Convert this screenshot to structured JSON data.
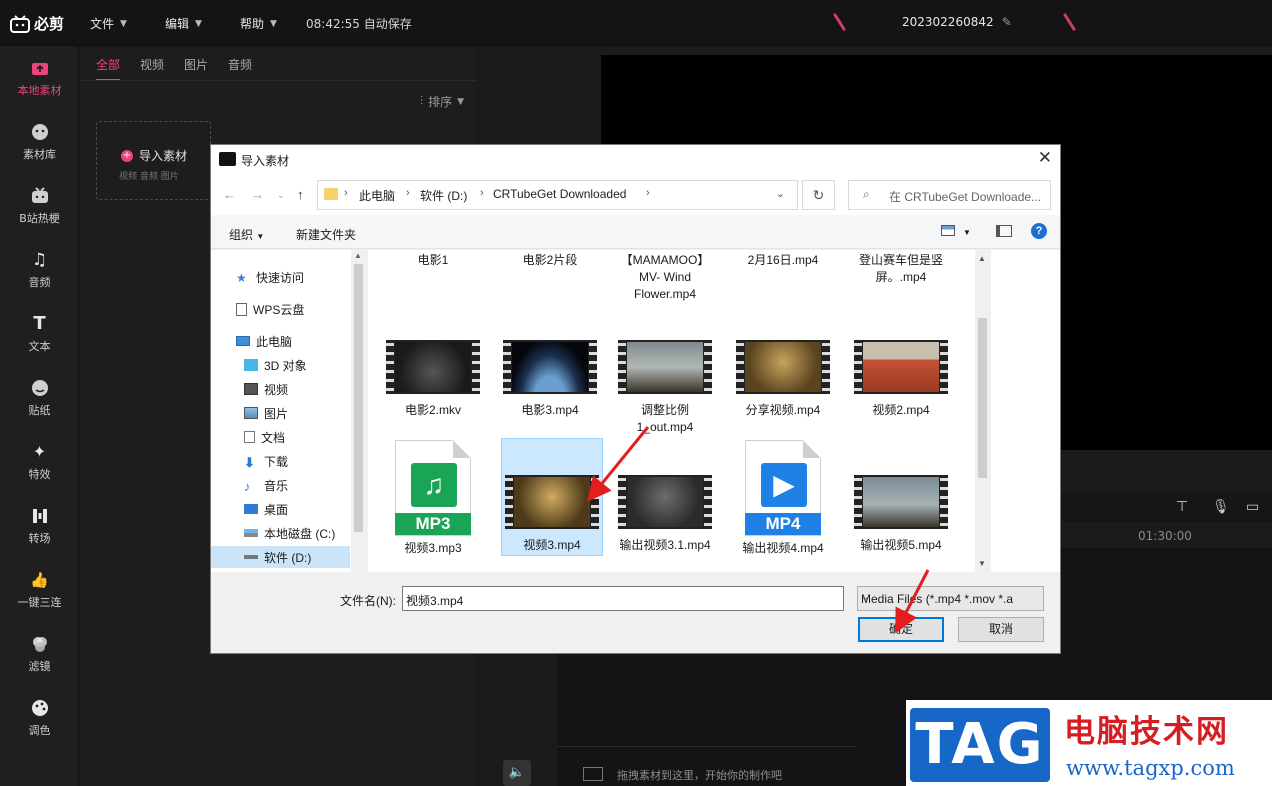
{
  "app": {
    "logo_text": "必剪",
    "menus": [
      "文件",
      "编辑",
      "帮助"
    ],
    "autosave": "08:42:55 自动保存",
    "project_name": "202302260842"
  },
  "sidebar": {
    "items": [
      {
        "label": "本地素材",
        "icon": "upload-icon"
      },
      {
        "label": "素材库",
        "icon": "face-icon"
      },
      {
        "label": "B站热梗",
        "icon": "tv-icon"
      },
      {
        "label": "音频",
        "icon": "music-note-icon"
      },
      {
        "label": "文本",
        "icon": "text-icon"
      },
      {
        "label": "贴纸",
        "icon": "sticker-icon"
      },
      {
        "label": "特效",
        "icon": "star-icon"
      },
      {
        "label": "转场",
        "icon": "transition-icon"
      },
      {
        "label": "一键三连",
        "icon": "thumbs-up-icon"
      },
      {
        "label": "滤镜",
        "icon": "filter-icon"
      },
      {
        "label": "调色",
        "icon": "palette-icon"
      }
    ]
  },
  "media_panel": {
    "tabs": [
      "全部",
      "视频",
      "图片",
      "音频"
    ],
    "sort_label": "排序",
    "import_label": "导入素材",
    "import_sub": "视频 音频 图片"
  },
  "timeline": {
    "time_mark": "01:30:00",
    "drop_hint": "拖拽素材到这里，开始你的制作吧"
  },
  "dialog": {
    "title": "导入素材",
    "path": [
      "此电脑",
      "软件 (D:)",
      "CRTubeGet Downloaded"
    ],
    "search_placeholder": "在 CRTubeGet Downloade...",
    "toolbar": {
      "organize": "组织",
      "new_folder": "新建文件夹"
    },
    "tree": [
      {
        "label": "快速访问",
        "icon": "star-icon"
      },
      {
        "label": "WPS云盘",
        "icon": "cloud-doc-icon"
      },
      {
        "label": "此电脑",
        "icon": "computer-icon"
      },
      {
        "label": "3D 对象",
        "icon": "cube-icon"
      },
      {
        "label": "视频",
        "icon": "film-icon"
      },
      {
        "label": "图片",
        "icon": "picture-icon"
      },
      {
        "label": "文档",
        "icon": "document-icon"
      },
      {
        "label": "下载",
        "icon": "download-icon"
      },
      {
        "label": "音乐",
        "icon": "music-note-icon"
      },
      {
        "label": "桌面",
        "icon": "desktop-icon"
      },
      {
        "label": "本地磁盘 (C:)",
        "icon": "drive-icon"
      },
      {
        "label": "软件 (D:)",
        "icon": "drive-icon"
      }
    ],
    "files_row0": [
      "电影1",
      "电影2片段",
      "【MAMAMOO】MV- Wind Flower.mp4",
      "2月16日.mp4",
      "登山赛车但是竖屏。.mp4"
    ],
    "files_row1": [
      "电影2.mkv",
      "电影3.mp4",
      "调整比例1_out.mp4",
      "分享视频.mp4",
      "视频2.mp4"
    ],
    "files_row2": [
      "视频3.mp3",
      "视频3.mp4",
      "输出视频3.1.mp4",
      "输出视频4.mp4",
      "输出视频5.mp4"
    ],
    "filename_label": "文件名(N):",
    "filename_value": "视频3.mp4",
    "filetype": "Media Files (*.mp4 *.mov *.a",
    "ok": "确定",
    "cancel": "取消"
  },
  "badges": {
    "mp3": "MP3",
    "mp4": "MP4"
  },
  "watermark": {
    "tag": "TAG",
    "site_name": "电脑技术网",
    "url": "www.tagxp.com"
  },
  "colors": {
    "accent": "#f0427a",
    "selection": "#cce8ff",
    "watermark_blue": "#1667c8",
    "watermark_red": "#d41e24",
    "mp3_green": "#1aa455",
    "mp4_blue": "#1f80e6"
  }
}
